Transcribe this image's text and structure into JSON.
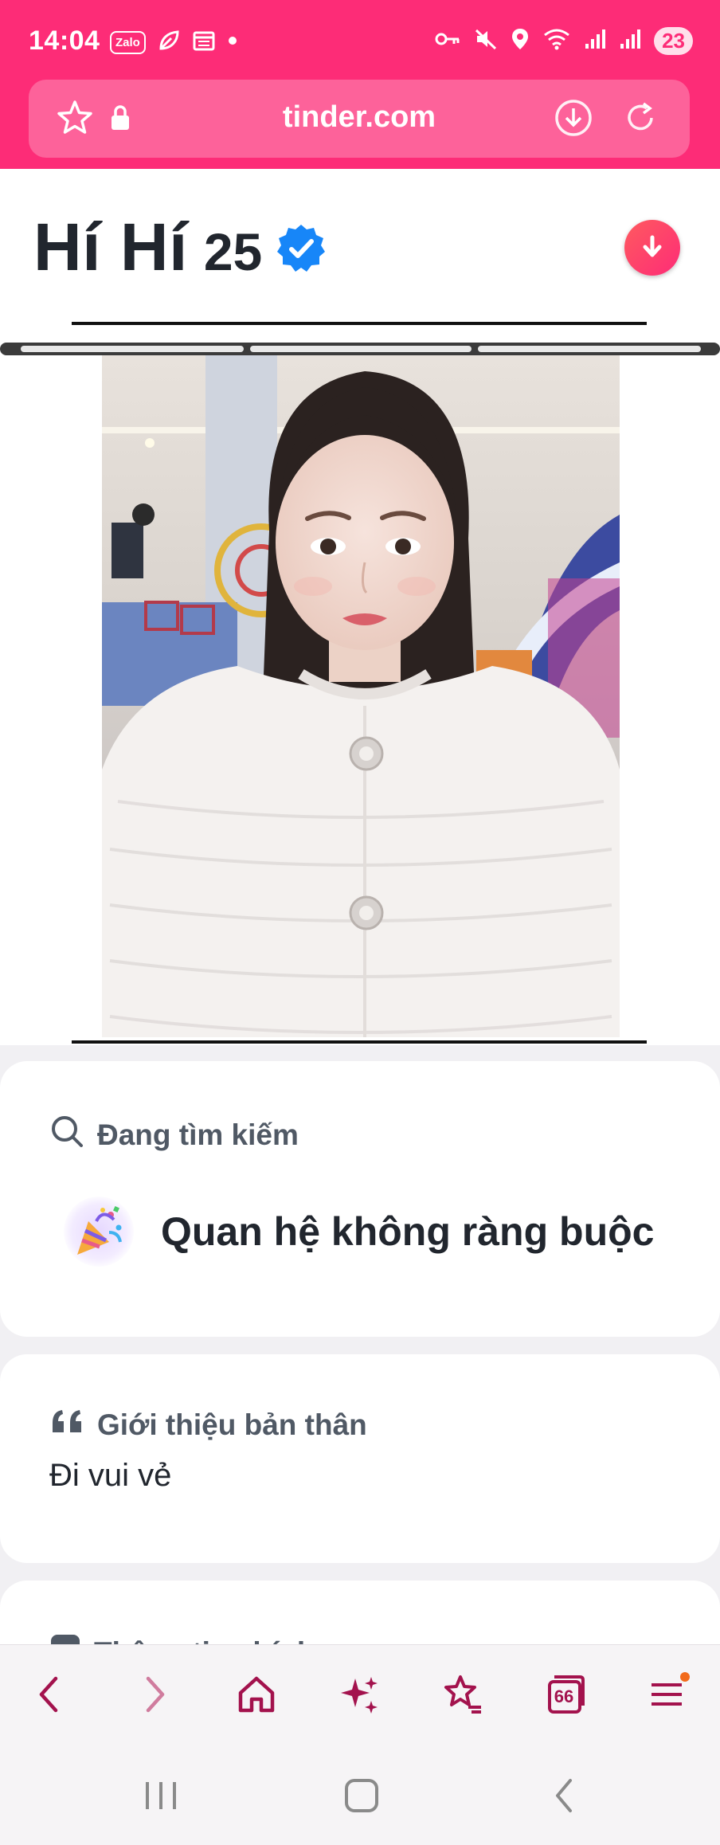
{
  "status_bar": {
    "time": "14:04",
    "app_badge": "Zalo",
    "battery": "23"
  },
  "browser": {
    "url": "tinder.com"
  },
  "profile": {
    "name": "Hí Hí",
    "age": "25",
    "verified": true
  },
  "photo_progress": {
    "segments": 3,
    "active": 1
  },
  "looking_for": {
    "label": "Đang tìm kiếm",
    "value": "Quan hệ không ràng buộc",
    "icon": "party-popper-icon"
  },
  "about": {
    "label": "Giới thiệu bản thân",
    "text": "Đi vui vẻ"
  },
  "basics": {
    "label": "Thông tin chính"
  },
  "bottom_nav": {
    "tabs_count": "66"
  },
  "colors": {
    "brand": "#fd2c77",
    "nav_icon": "#a3124d",
    "text_dark": "#21262e",
    "text_muted": "#505965",
    "verified": "#1786f8"
  }
}
